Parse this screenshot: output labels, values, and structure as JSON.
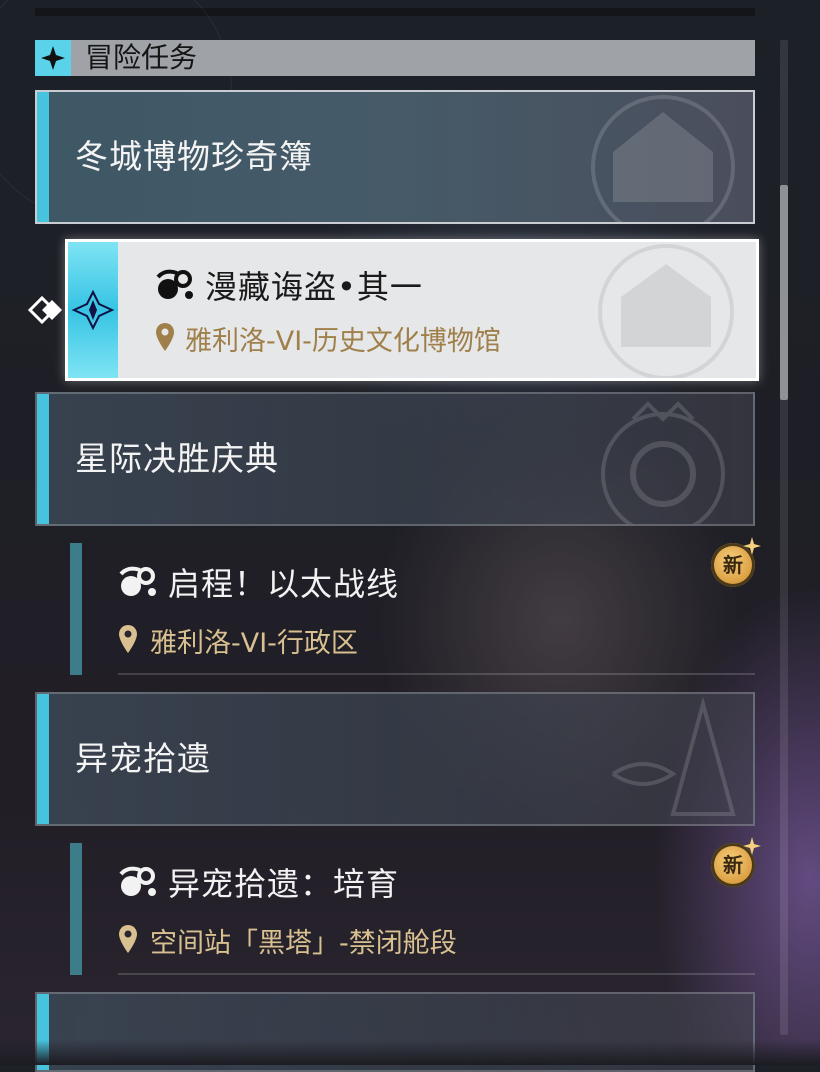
{
  "section": {
    "title": "冒险任务",
    "icon": "diamond-star-icon"
  },
  "groups": [
    {
      "title": "冬城博物珍奇簿"
    },
    {
      "title": "星际决胜庆典"
    },
    {
      "title": "异宠拾遗"
    },
    {
      "title": ""
    }
  ],
  "quests": [
    {
      "title": "漫藏诲盗•其一",
      "location": "雅利洛-VI-历史文化博物馆",
      "selected": true,
      "is_new": false
    },
    {
      "title": "启程！以太战线",
      "location": "雅利洛-VI-行政区",
      "selected": false,
      "is_new": true
    },
    {
      "title": "异宠拾遗：培育",
      "location": "空间站「黑塔」-禁闭舱段",
      "selected": false,
      "is_new": true
    }
  ],
  "badge": {
    "new_label": "新"
  },
  "colors": {
    "accent": "#46c4dd",
    "location_text": "#d8c090",
    "badge": "#e7b255"
  }
}
